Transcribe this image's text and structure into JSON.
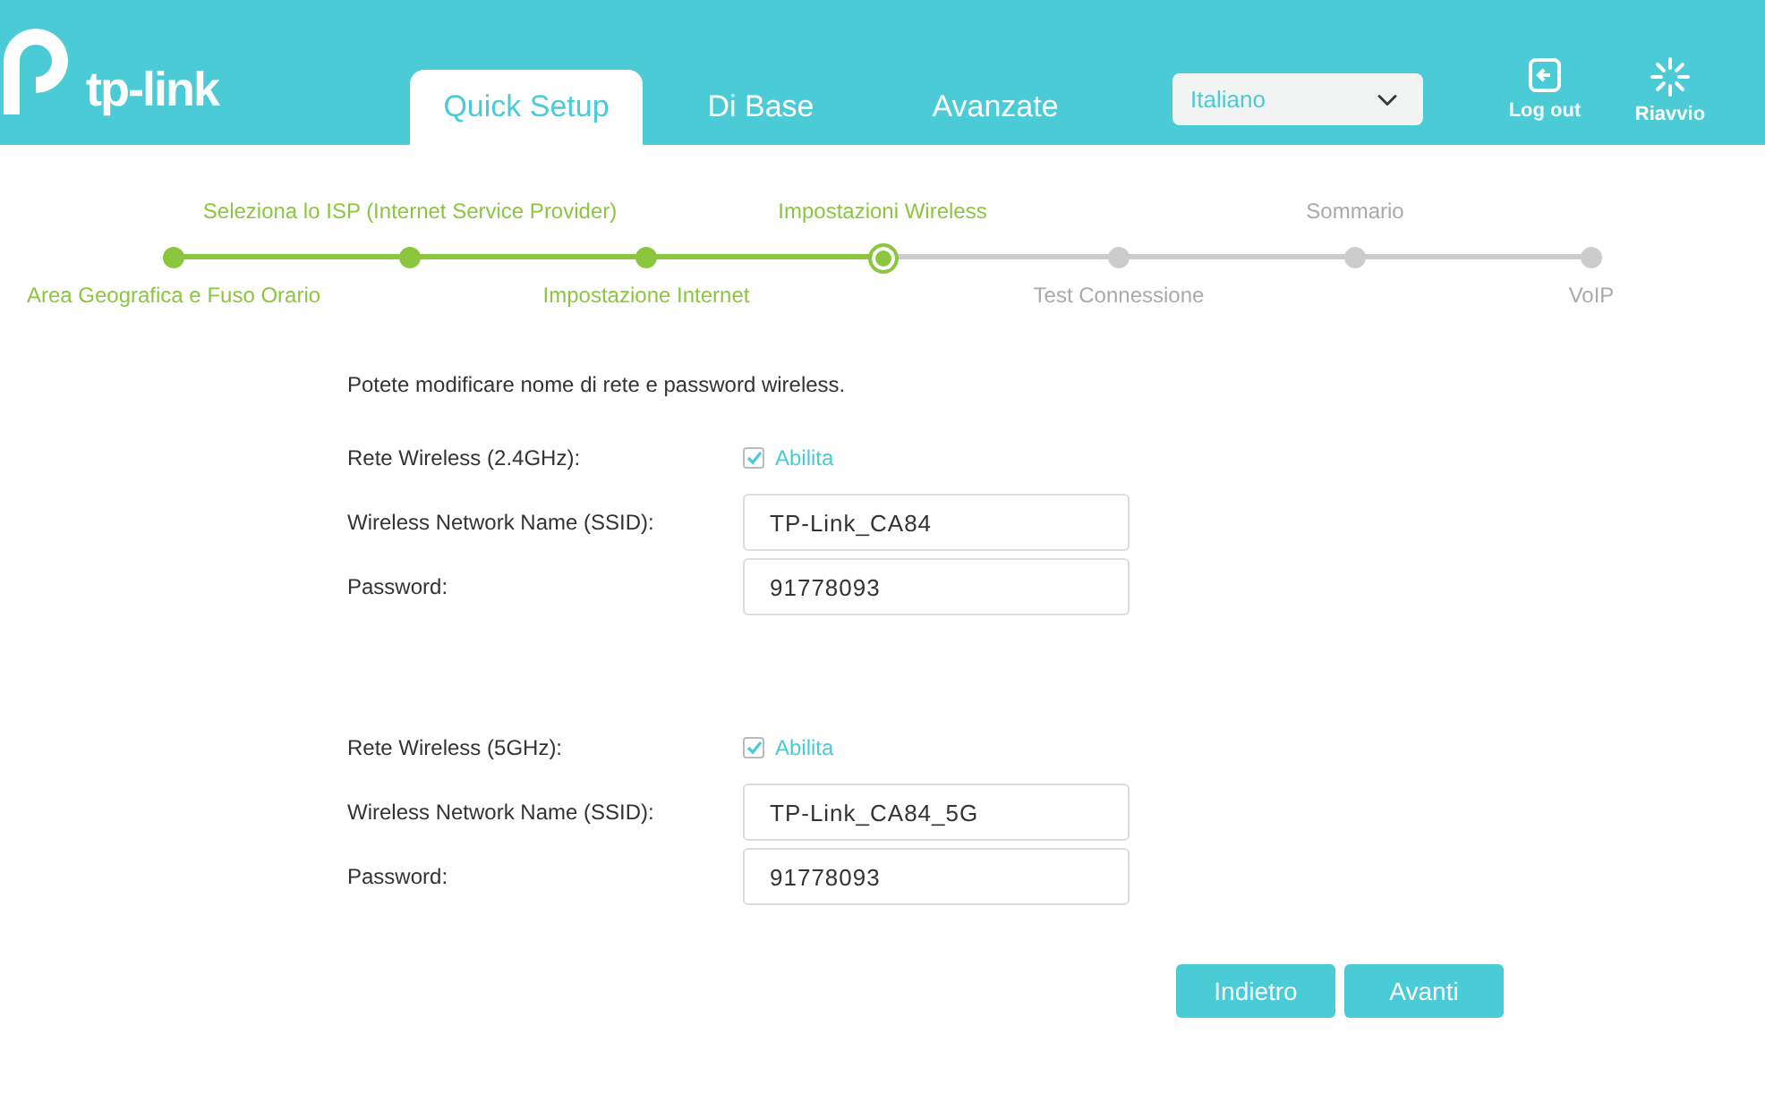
{
  "header": {
    "logo_text": "tp-link",
    "tabs": [
      {
        "label": "Quick Setup",
        "selected": true
      },
      {
        "label": "Di Base",
        "selected": false
      },
      {
        "label": "Avanzate",
        "selected": false
      }
    ],
    "language": "Italiano",
    "actions": [
      {
        "kind": "logout",
        "label": "Log out"
      },
      {
        "kind": "reboot",
        "label": "Riavvio"
      }
    ]
  },
  "steps": [
    {
      "label": "Area Geografica e Fuso Orario",
      "completed": true,
      "selected": false
    },
    {
      "label": "Seleziona lo ISP (Internet Service Provider)",
      "completed": true,
      "selected": false
    },
    {
      "label": "Impostazione Internet",
      "completed": true,
      "selected": false
    },
    {
      "label": "Impostazioni Wireless",
      "completed": false,
      "selected": true
    },
    {
      "label": "Test Connessione",
      "completed": false,
      "selected": false
    },
    {
      "label": "Sommario",
      "completed": false,
      "selected": false
    },
    {
      "label": "VoIP",
      "completed": false,
      "selected": false
    }
  ],
  "intro": "Potete modificare nome di rete e password wireless.",
  "bands": [
    {
      "enable_label": "Rete Wireless (2.4GHz):",
      "enable_text": "Abilita",
      "checked": true,
      "ssid_label": "Wireless Network Name (SSID):",
      "ssid": "TP-Link_CA84",
      "password_label": "Password:",
      "password": "91778093"
    },
    {
      "enable_label": "Rete Wireless (5GHz):",
      "enable_text": "Abilita",
      "checked": true,
      "ssid_label": "Wireless Network Name (SSID):",
      "ssid": "TP-Link_CA84_5G",
      "password_label": "Password:",
      "password": "91778093"
    }
  ],
  "buttons": [
    "Indietro",
    "Avanti"
  ]
}
